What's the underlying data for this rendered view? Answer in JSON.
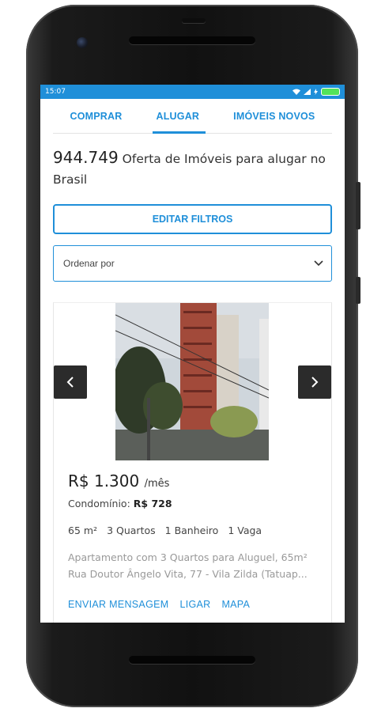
{
  "status": {
    "time": "15:07"
  },
  "tabs": [
    {
      "label": "COMPRAR"
    },
    {
      "label": "ALUGAR"
    },
    {
      "label": "IMÓVEIS NOVOS"
    }
  ],
  "headline": {
    "count": "944.749",
    "text": "Oferta de Imóveis para alugar no Brasil"
  },
  "filters_button": "EDITAR FILTROS",
  "sort": {
    "placeholder": "Ordenar por"
  },
  "listing": {
    "price": "R$ 1.300",
    "price_unit": "/mês",
    "condo_label": "Condomínio:",
    "condo_value": "R$ 728",
    "features": [
      "65 m²",
      "3 Quartos",
      "1 Banheiro",
      "1 Vaga"
    ],
    "description_line1": "Apartamento com 3 Quartos para Aluguel, 65m²",
    "description_line2": "Rua Doutor Ângelo Vita, 77 - Vila Zilda (Tatuap...",
    "actions": [
      "ENVIAR MENSAGEM",
      "LIGAR",
      "MAPA"
    ]
  },
  "colors": {
    "accent": "#1f8fd9",
    "status_bar": "#1f8fd9"
  },
  "icons": {
    "prev": "chevron-left-icon",
    "next": "chevron-right-icon",
    "dropdown": "chevron-down-icon"
  }
}
